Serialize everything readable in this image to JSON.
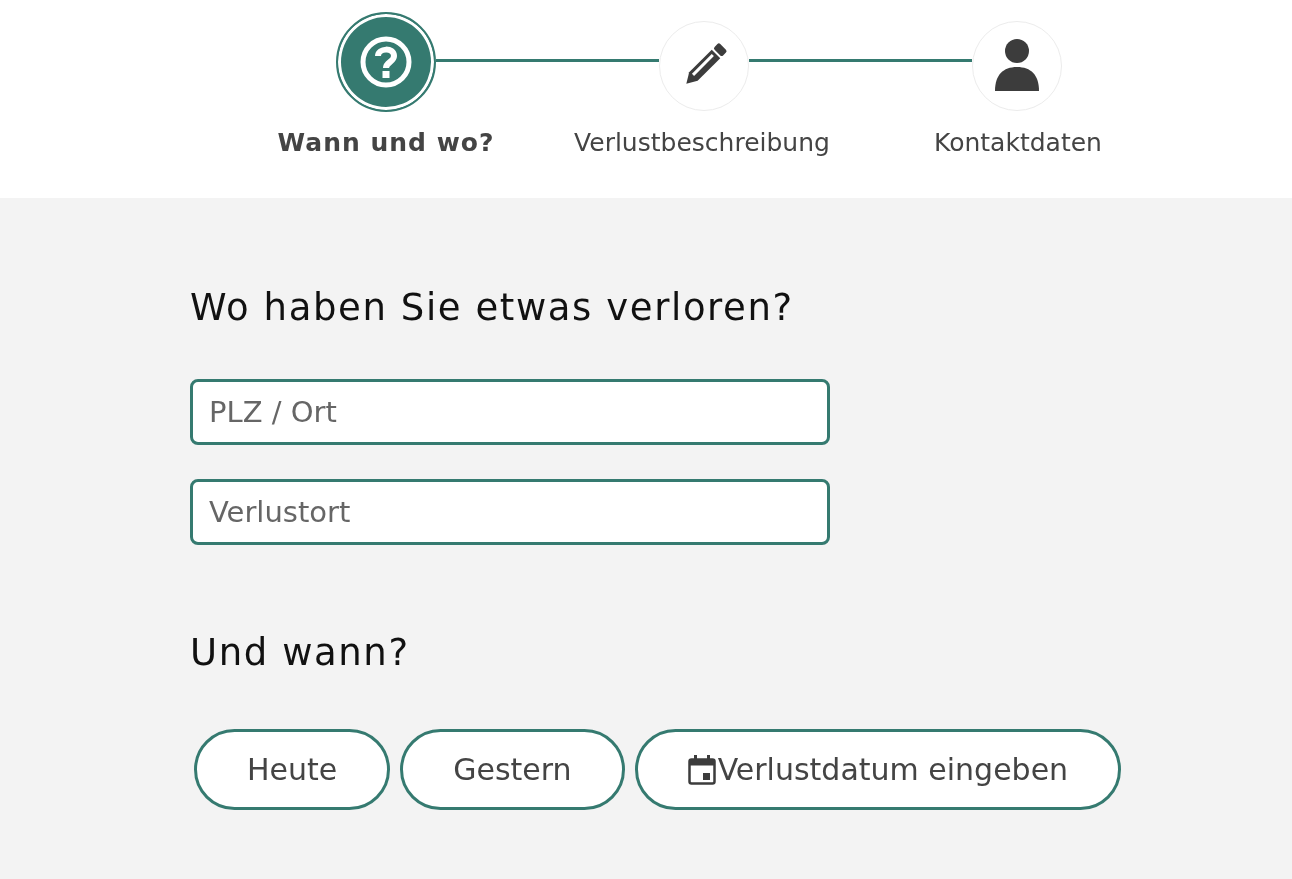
{
  "steps": [
    {
      "label": "Wann und wo?",
      "selected": true
    },
    {
      "label": "Verlustbeschreibung",
      "selected": false
    },
    {
      "label": "Kontaktdaten",
      "selected": false
    }
  ],
  "location_section": {
    "heading": "Wo haben Sie etwas verloren?",
    "fields": [
      {
        "placeholder": "PLZ / Ort"
      },
      {
        "placeholder": "Verlustort"
      }
    ]
  },
  "date_section": {
    "heading": "Und wann?",
    "buttons": [
      {
        "kind": "preset",
        "label": "Heute"
      },
      {
        "kind": "preset",
        "label": "Gestern"
      },
      {
        "kind": "picker",
        "label": "Verlustdatum eingeben"
      }
    ]
  }
}
